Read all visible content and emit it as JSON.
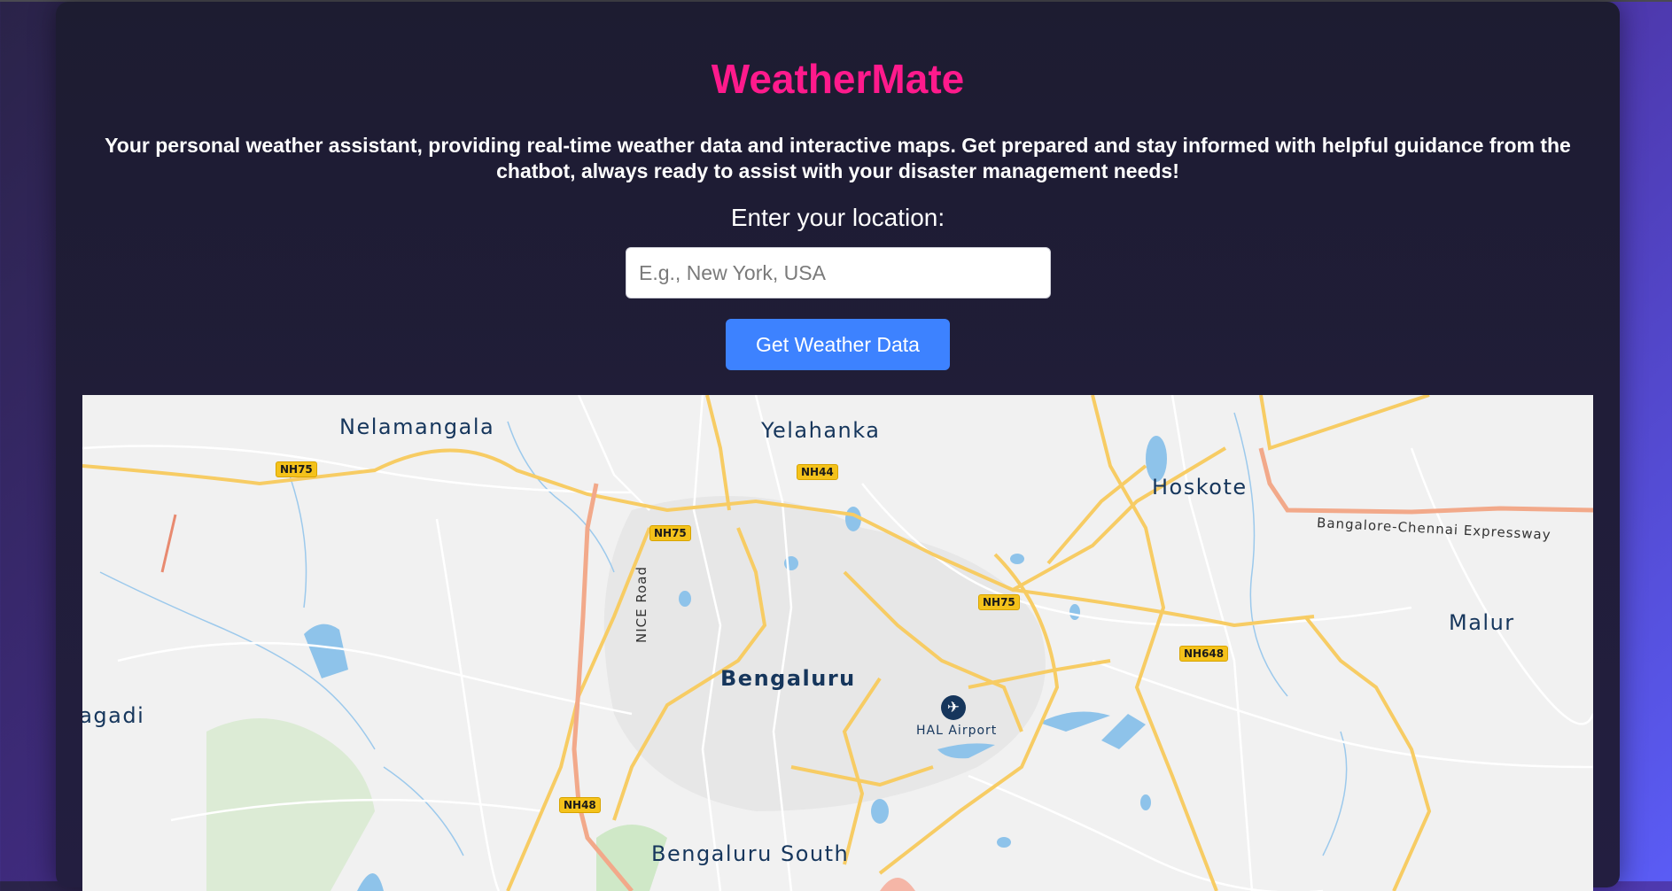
{
  "app": {
    "title": "WeatherMate",
    "tagline": "Your personal weather assistant, providing real-time weather data and interactive maps. Get prepared and stay informed with helpful guidance from the chatbot, always ready to assist with your disaster management needs!"
  },
  "location_form": {
    "label": "Enter your location:",
    "input_value": "",
    "placeholder": "E.g., New York, USA",
    "submit_label": "Get Weather Data"
  },
  "map": {
    "places": {
      "nelamangala": "Nelamangala",
      "yelahanka": "Yelahanka",
      "hoskote": "Hoskote",
      "malur": "Malur",
      "magadi": "Magadi",
      "bengaluru": "Bengaluru",
      "bengaluru_south": "Bengaluru South",
      "hal_airport": "HAL Airport"
    },
    "highway_shields": {
      "nh75_west": "NH75",
      "nh44": "NH44",
      "nh75_center": "NH75",
      "nh75_east": "NH75",
      "nh648": "NH648",
      "nh48": "NH48"
    },
    "roads": {
      "nice_road": "NICE Road",
      "expressway": "Bangalore-Chennai Expressway"
    },
    "colors": {
      "land": "#f1f1f1",
      "highway": "#f7cc64",
      "major_road": "#ffffff",
      "water": "#8ec3ea",
      "park": "#a8dca0",
      "expressway": "#f2a98a"
    }
  },
  "theme": {
    "accent_title": "#ff1a8c",
    "button": "#3d82ff",
    "card_bg": "#1d1c31"
  }
}
